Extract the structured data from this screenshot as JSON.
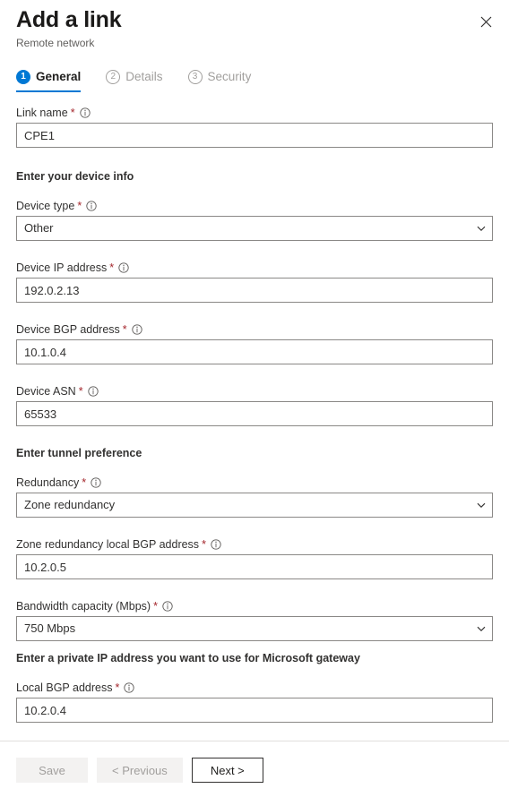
{
  "header": {
    "title": "Add a link",
    "subtitle": "Remote network",
    "close_label": "Close"
  },
  "tabs": [
    {
      "num": "1",
      "label": "General",
      "active": true
    },
    {
      "num": "2",
      "label": "Details",
      "active": false
    },
    {
      "num": "3",
      "label": "Security",
      "active": false
    }
  ],
  "fields": {
    "link_name": {
      "label": "Link name",
      "value": "CPE1"
    },
    "device_type": {
      "label": "Device type",
      "value": "Other"
    },
    "device_ip": {
      "label": "Device IP address",
      "value": "192.0.2.13"
    },
    "device_bgp": {
      "label": "Device BGP address",
      "value": "10.1.0.4"
    },
    "device_asn": {
      "label": "Device ASN",
      "value": "65533"
    },
    "redundancy": {
      "label": "Redundancy",
      "value": "Zone redundancy"
    },
    "zone_bgp": {
      "label": "Zone redundancy local BGP address",
      "value": "10.2.0.5"
    },
    "bandwidth": {
      "label": "Bandwidth capacity (Mbps)",
      "value": "750 Mbps"
    },
    "local_bgp": {
      "label": "Local BGP address",
      "value": "10.2.0.4"
    }
  },
  "sections": {
    "device_info": "Enter your device info",
    "tunnel_pref": "Enter tunnel preference",
    "gateway_ip": "Enter a private IP address you want to use for Microsoft gateway"
  },
  "required_marker": "*",
  "footer": {
    "save": "Save",
    "previous": "< Previous",
    "next": "Next >"
  },
  "colors": {
    "accent": "#0078d4",
    "required": "#a4262c",
    "border": "#8a8886",
    "text": "#323130",
    "muted": "#a19f9d"
  }
}
